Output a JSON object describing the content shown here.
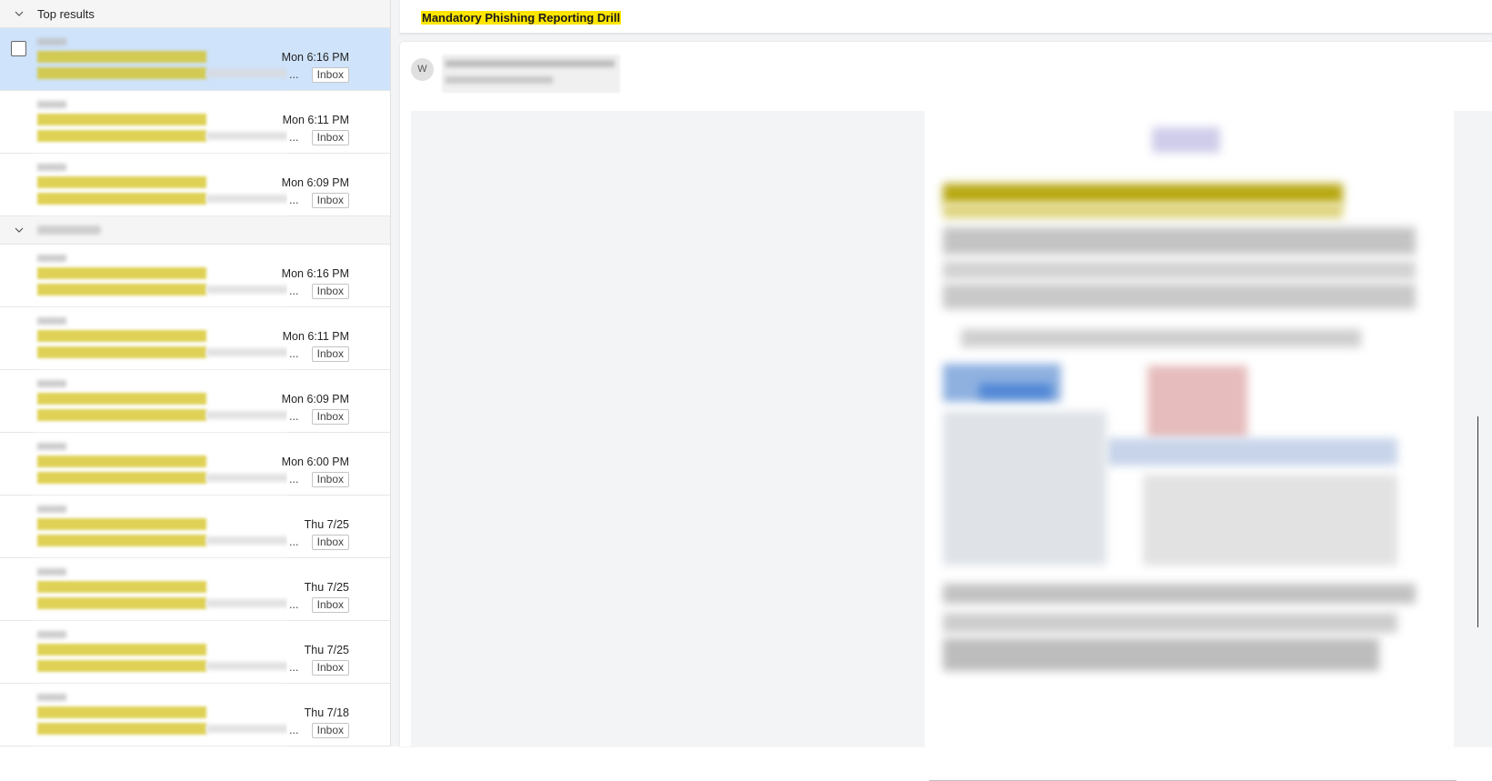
{
  "list": {
    "groups": [
      {
        "label": "Top results",
        "rows": [
          {
            "time": "Mon 6:16 PM",
            "folder": "Inbox",
            "selected": true
          },
          {
            "time": "Mon 6:11 PM",
            "folder": "Inbox"
          },
          {
            "time": "Mon 6:09 PM",
            "folder": "Inbox"
          }
        ]
      },
      {
        "label": "",
        "rows": [
          {
            "time": "Mon 6:16 PM",
            "folder": "Inbox"
          },
          {
            "time": "Mon 6:11 PM",
            "folder": "Inbox"
          },
          {
            "time": "Mon 6:09 PM",
            "folder": "Inbox"
          },
          {
            "time": "Mon 6:00 PM",
            "folder": "Inbox"
          },
          {
            "time": "Thu 7/25",
            "folder": "Inbox"
          },
          {
            "time": "Thu 7/25",
            "folder": "Inbox"
          },
          {
            "time": "Thu 7/25",
            "folder": "Inbox"
          },
          {
            "time": "Thu 7/18",
            "folder": "Inbox",
            "attachment_icon": "paperclip-icon"
          }
        ]
      }
    ],
    "ellipsis": "..."
  },
  "reading": {
    "subject": "Mandatory Phishing Reporting Drill",
    "avatar_initial": "W"
  },
  "colors": {
    "selected_row": "#cfe3fa",
    "search_highlight": "#ffe500",
    "pane_background": "#f3f4f6"
  }
}
